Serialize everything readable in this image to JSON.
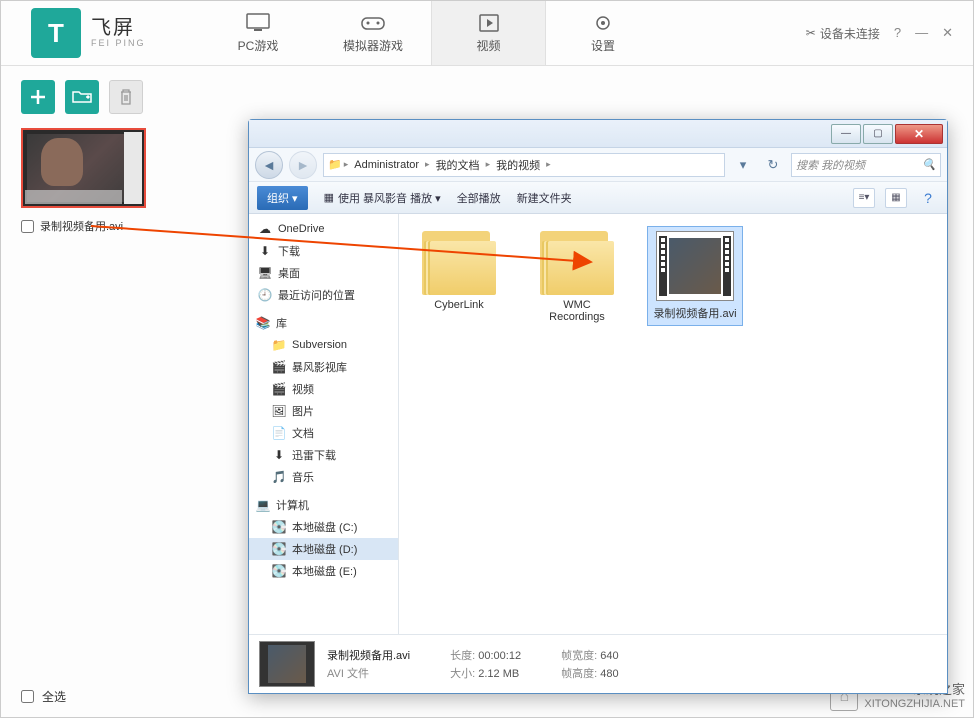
{
  "app": {
    "logo_cn": "飞屏",
    "logo_en": "FEI PING",
    "tabs": [
      {
        "label": "PC游戏",
        "icon": "monitor"
      },
      {
        "label": "模拟器游戏",
        "icon": "gamepad"
      },
      {
        "label": "视频",
        "icon": "play"
      },
      {
        "label": "设置",
        "icon": "gear"
      }
    ],
    "active_tab": 2,
    "device_status": "设备未连接",
    "toolbar": {
      "add": "+",
      "folder": "folder",
      "trash": "trash"
    },
    "video_item": {
      "name": "录制视频备用.avi"
    },
    "select_all": "全选"
  },
  "explorer": {
    "breadcrumb": [
      "Administrator",
      "我的文档",
      "我的视频"
    ],
    "search_placeholder": "搜索 我的视频",
    "toolbar": {
      "organize": "组织 ▾",
      "play": "使用 暴风影音 播放 ▾",
      "play_all": "全部播放",
      "new_folder": "新建文件夹"
    },
    "tree": {
      "favorites": [
        {
          "label": "OneDrive",
          "icon": "cloud"
        },
        {
          "label": "下载",
          "icon": "download"
        },
        {
          "label": "桌面",
          "icon": "desktop"
        },
        {
          "label": "最近访问的位置",
          "icon": "recent"
        }
      ],
      "libraries_label": "库",
      "libraries": [
        {
          "label": "Subversion",
          "icon": "svn"
        },
        {
          "label": "暴风影视库",
          "icon": "video"
        },
        {
          "label": "视频",
          "icon": "video"
        },
        {
          "label": "图片",
          "icon": "image"
        },
        {
          "label": "文档",
          "icon": "doc"
        },
        {
          "label": "迅雷下载",
          "icon": "download"
        },
        {
          "label": "音乐",
          "icon": "music"
        }
      ],
      "computer_label": "计算机",
      "drives": [
        {
          "label": "本地磁盘 (C:)"
        },
        {
          "label": "本地磁盘 (D:)"
        },
        {
          "label": "本地磁盘 (E:)"
        }
      ],
      "selected_drive": 1
    },
    "files": [
      {
        "name": "CyberLink",
        "type": "folder"
      },
      {
        "name": "WMC Recordings",
        "type": "folder"
      },
      {
        "name": "录制视频备用.avi",
        "type": "video",
        "selected": true
      }
    ],
    "details": {
      "name": "录制视频备用.avi",
      "type": "AVI 文件",
      "length_label": "长度:",
      "length": "00:00:12",
      "size_label": "大小:",
      "size": "2.12 MB",
      "width_label": "帧宽度:",
      "width": "640",
      "height_label": "帧高度:",
      "height": "480"
    }
  },
  "watermark": {
    "line1": "系统之家",
    "line2": "XITONGZHIJIA.NET"
  }
}
